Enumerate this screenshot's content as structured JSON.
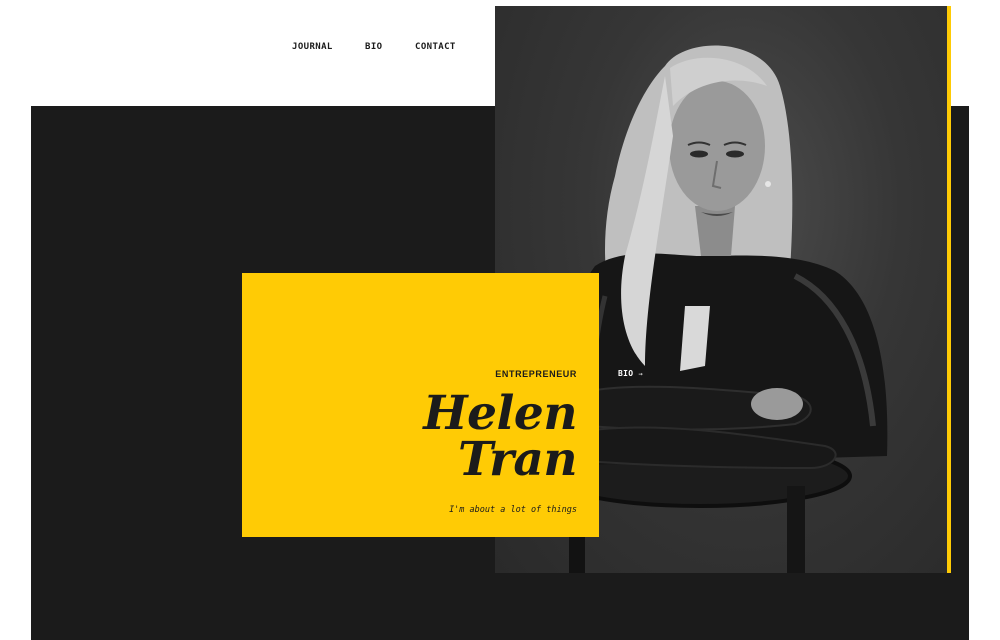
{
  "nav": {
    "items": [
      "JOURNAL",
      "BIO",
      "CONTACT"
    ]
  },
  "hero": {
    "role": "ENTREPRENEUR",
    "name_first": "Helen",
    "name_last": "Tran",
    "tagline": "I'm about a lot of things",
    "photo_tag": "BIO",
    "photo_tag_arrow": "→",
    "photo_alt": "Portrait photo of a woman with long blonde hair in a black leather jacket, seated on a chair"
  },
  "colors": {
    "accent": "#ffcb05",
    "dark": "#1b1b1b",
    "background": "#ffffff"
  }
}
